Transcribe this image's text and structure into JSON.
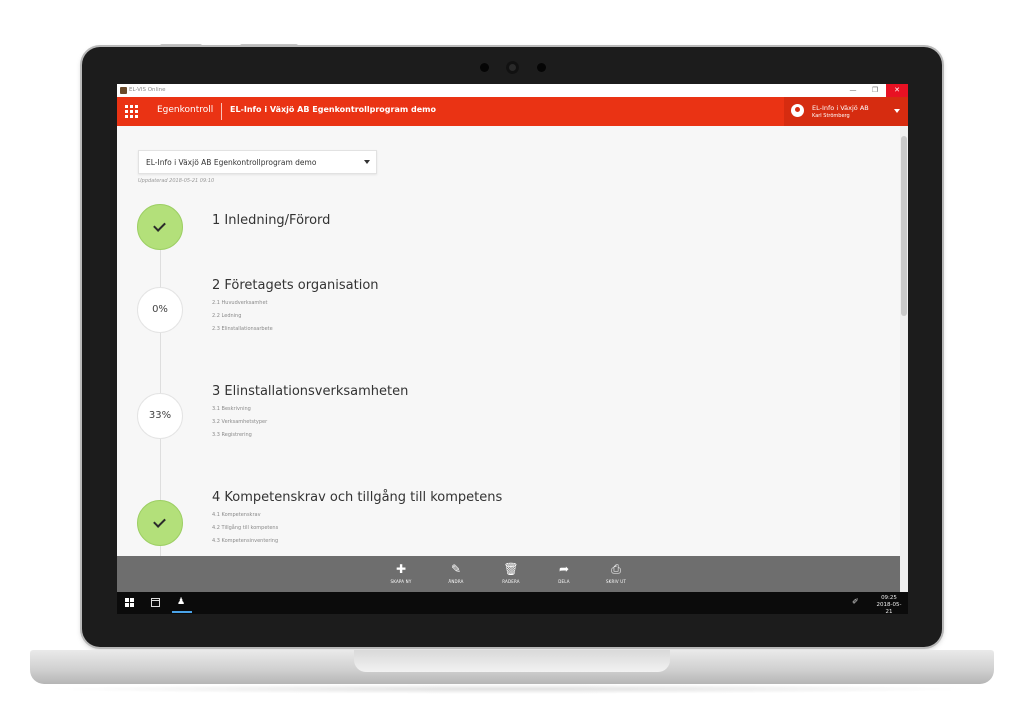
{
  "window": {
    "title": "EL-VIS Online",
    "minimize": "—",
    "restore": "❐",
    "close": "✕"
  },
  "appbar": {
    "app_name": "Egenkontroll",
    "document_name": "EL-Info i Växjö AB Egenkontrollprogram demo",
    "user_org": "EL-Info i Växjö AB",
    "user_name": "Karl Strömberg"
  },
  "program_select": {
    "value": "EL-Info i Växjö AB Egenkontrollprogram demo"
  },
  "updated_text": "Uppdaterad 2018-05-21 09:10",
  "sections": [
    {
      "title": "1 Inledning/Förord",
      "status": "done",
      "progress": "",
      "items": []
    },
    {
      "title": "2 Företagets organisation",
      "status": "partial",
      "progress": "0%",
      "items": [
        "2.1 Huvudverksamhet",
        "2.2 Ledning",
        "2.3 Elinstallationsarbete"
      ]
    },
    {
      "title": "3 Elinstallationsverksamheten",
      "status": "partial",
      "progress": "33%",
      "items": [
        "3.1 Beskrivning",
        "3.2 Verksamhetstyper",
        "3.3 Registrering"
      ]
    },
    {
      "title": "4 Kompetenskrav och tillgång till kompetens",
      "status": "done",
      "progress": "",
      "items": [
        "4.1 Kompetenskrav",
        "4.2 Tillgång till kompetens",
        "4.3 Kompetensinventering"
      ]
    }
  ],
  "toolbar": {
    "create": "SKAPA NY",
    "edit": "ÄNDRA",
    "delete": "RADERA",
    "share": "DELA",
    "print": "SKRIV UT"
  },
  "taskbar": {
    "time": "09:25",
    "date": "2018-05-21"
  },
  "colors": {
    "accent": "#ea3314",
    "done": "#b3e07a",
    "toolbar": "#6e6e6e"
  }
}
